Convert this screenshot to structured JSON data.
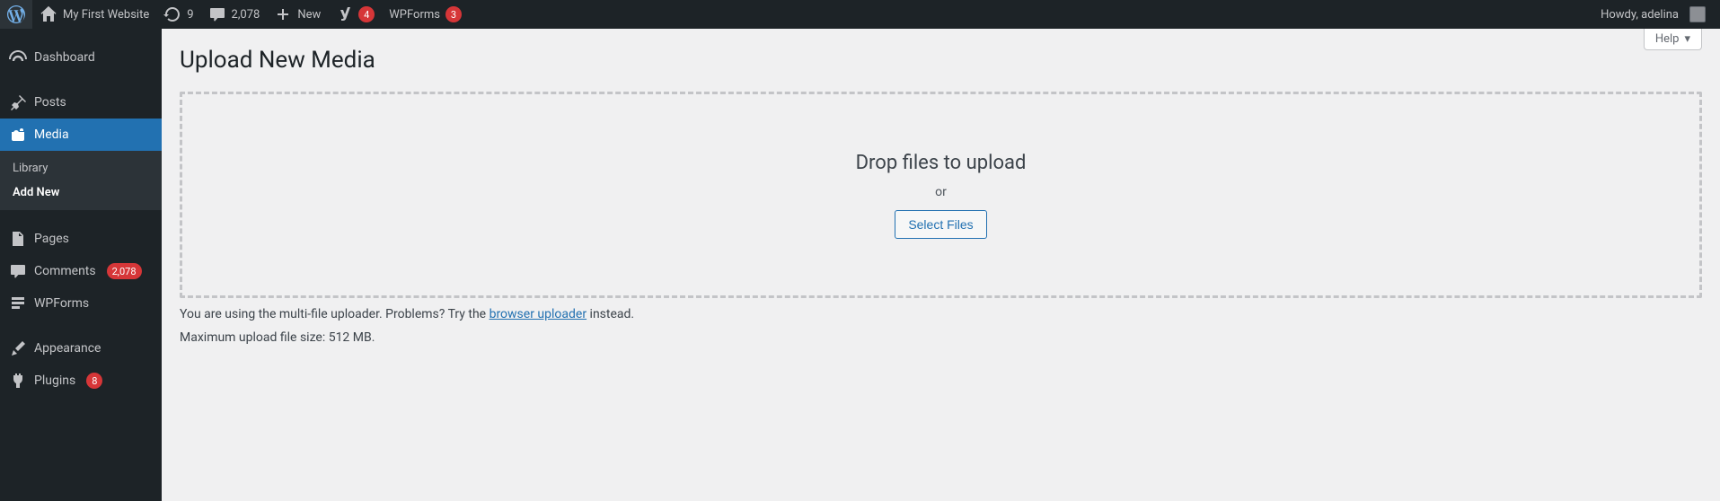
{
  "adminbar": {
    "site_name": "My First Website",
    "updates_count": "9",
    "comments_count": "2,078",
    "new_label": "New",
    "yoast_count": "4",
    "wpforms_label": "WPForms",
    "wpforms_count": "3",
    "howdy": "Howdy, adelina"
  },
  "sidebar": {
    "dashboard": "Dashboard",
    "posts": "Posts",
    "media": "Media",
    "media_sub": {
      "library": "Library",
      "add_new": "Add New"
    },
    "pages": "Pages",
    "comments": "Comments",
    "comments_count": "2,078",
    "wpforms": "WPForms",
    "appearance": "Appearance",
    "plugins": "Plugins",
    "plugins_count": "8"
  },
  "content": {
    "help_label": "Help",
    "page_title": "Upload New Media",
    "drop_instructions": "Drop files to upload",
    "or": "or",
    "select_files": "Select Files",
    "note_prefix": "You are using the multi-file uploader. Problems? Try the ",
    "note_link": "browser uploader",
    "note_suffix": " instead.",
    "max_size": "Maximum upload file size: 512 MB."
  }
}
